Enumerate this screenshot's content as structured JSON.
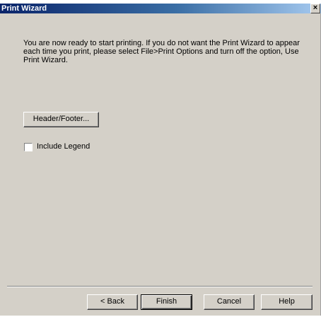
{
  "window": {
    "title": "Print Wizard",
    "close_glyph": "×"
  },
  "message": "You are now ready to start printing. If you do not want the Print Wizard to appear each time you print, please select File>Print Options and turn off the option, Use Print Wizard.",
  "header_footer_label": "Header/Footer...",
  "include_legend": {
    "label": "Include Legend",
    "checked": false
  },
  "buttons": {
    "back": "< Back",
    "finish": "Finish",
    "cancel": "Cancel",
    "help": "Help"
  }
}
